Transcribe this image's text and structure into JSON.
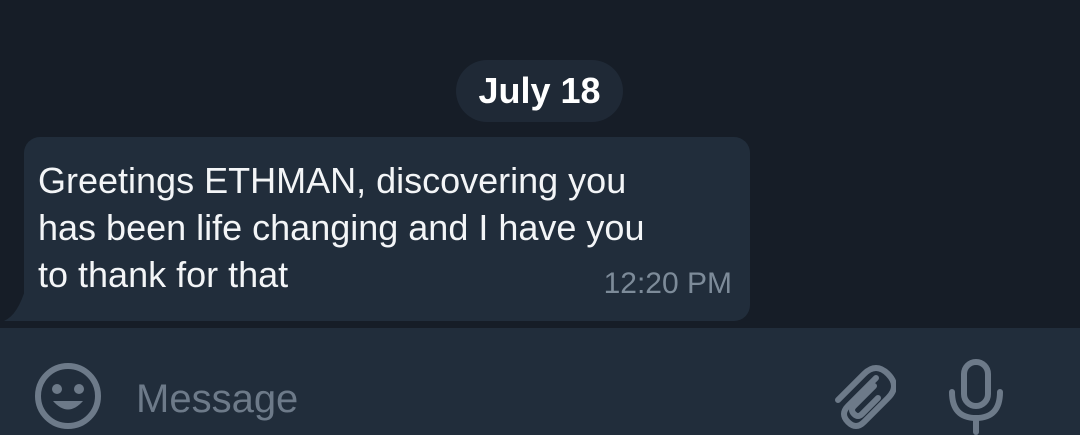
{
  "date_separator": "July 18",
  "message": {
    "text": "Greetings ETHMAN, discovering you\nhas been life changing and I have you\nto thank for that",
    "time": "12:20 PM"
  },
  "composer": {
    "placeholder": "Message",
    "value": ""
  },
  "icons": {
    "emoji": "smiley-face-icon",
    "attach": "paperclip-icon",
    "mic": "microphone-icon"
  },
  "colors": {
    "background": "#161d27",
    "bubble": "#212d3b",
    "input_bar": "#212d3b",
    "text": "#f3f5f7",
    "muted": "#7d8b99"
  }
}
